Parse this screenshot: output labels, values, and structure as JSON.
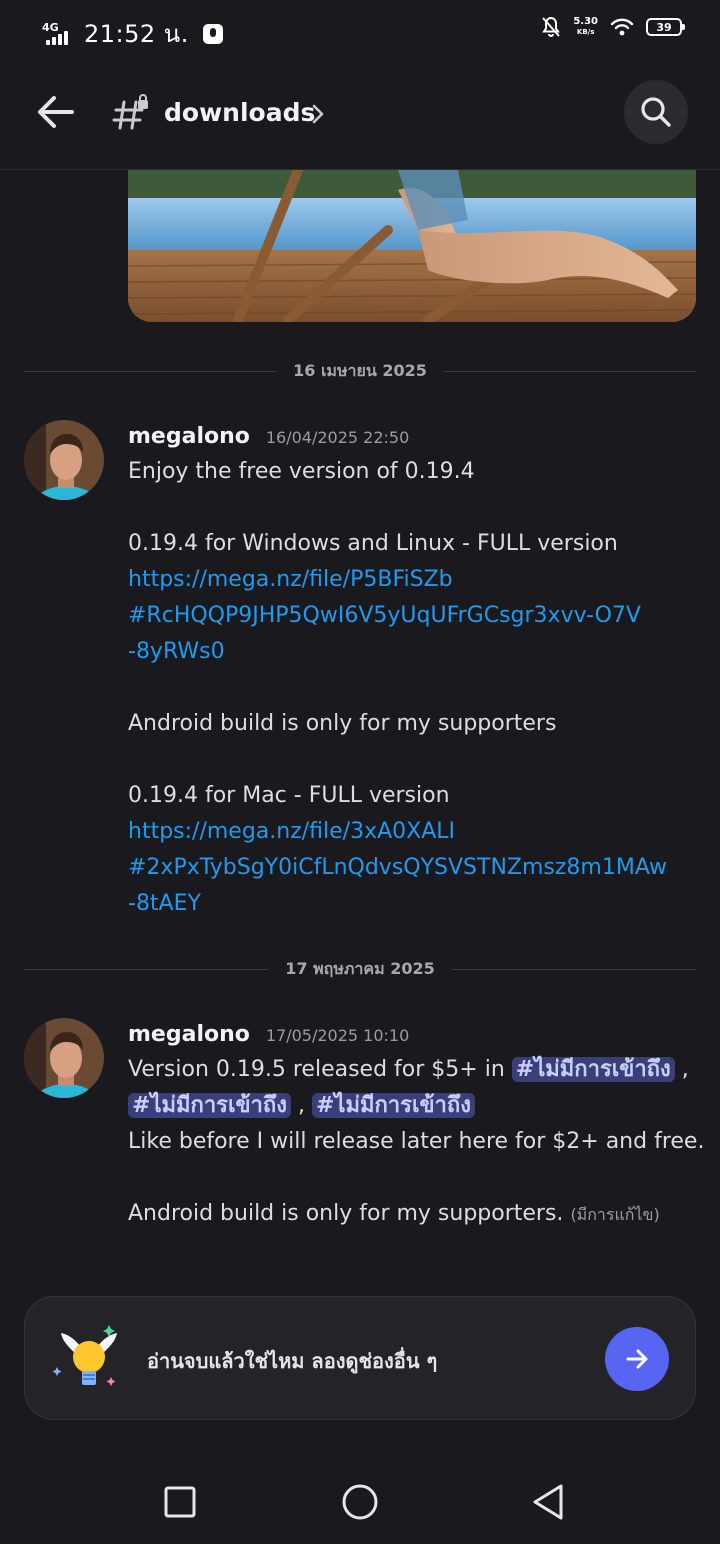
{
  "status_bar": {
    "network": "4G",
    "time": "21:52 น.",
    "speed_value": "5.30",
    "speed_unit": "KB/s",
    "battery": "39"
  },
  "header": {
    "channel_name": "downloads",
    "icons": {
      "back": "arrow-left-icon",
      "channel": "locked-hash-icon",
      "chevron": "chevron-right-icon",
      "search": "search-icon"
    }
  },
  "dividers": [
    {
      "date": "16 เมษายน 2025"
    },
    {
      "date": "17 พฤษภาคม 2025"
    }
  ],
  "messages": [
    {
      "author": "megalono",
      "timestamp": "16/04/2025 22:50",
      "lines": {
        "l1": "Enjoy the free version of 0.19.4",
        "l2": "0.19.4 for Windows and Linux - FULL version",
        "l3": "https://mega.nz/file/P5BFiSZb",
        "l4": "#RcHQQP9JHP5QwI6V5yUqUFrGCsgr3xvv-O7V",
        "l5": "-8yRWs0",
        "l6": "Android build is only for my supporters",
        "l7": "0.19.4 for Mac - FULL version",
        "l8": "https://mega.nz/file/3xA0XALI",
        "l9": "#2xPxTybSgY0iCfLnQdvsQYSVSTNZmsz8m1MAw",
        "l10": "-8tAEY"
      }
    },
    {
      "author": "megalono",
      "timestamp": "17/05/2025 10:10",
      "lines": {
        "l1": "Version 0.19.5 released for $5+ in",
        "mention": "ไม่มีการเข้าถึง",
        "sep": ",",
        "l3": "Like before I will release later here for $2+ and free.",
        "l4": "Android build is only for my supporters.",
        "edited": "(มีการแก้ไข)"
      }
    }
  ],
  "suggestion_card": {
    "text": "อ่านจบแล้วใช่ไหม ลองดูช่องอื่น ๆ",
    "icons": {
      "art": "winged-lightbulb-icon",
      "go": "arrow-right-icon"
    },
    "button_color": "#5865f2"
  },
  "nav_bar": {
    "icons": {
      "recents": "square-icon",
      "home": "circle-icon",
      "back": "triangle-back-icon"
    }
  },
  "colors": {
    "background": "#1a1a1e",
    "link": "#1e9bf0",
    "mention_bg": "#3a3f7a",
    "accent": "#5865f2"
  }
}
